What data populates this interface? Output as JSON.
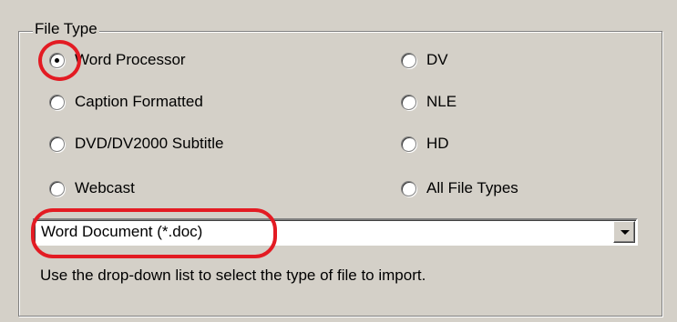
{
  "group": {
    "title": "File Type",
    "radios": [
      {
        "label": "Word Processor",
        "selected": true
      },
      {
        "label": "Caption Formatted",
        "selected": false
      },
      {
        "label": "DVD/DV2000 Subtitle",
        "selected": false
      },
      {
        "label": "Webcast",
        "selected": false
      },
      {
        "label": "DV",
        "selected": false
      },
      {
        "label": "NLE",
        "selected": false
      },
      {
        "label": "HD",
        "selected": false
      },
      {
        "label": "All File Types",
        "selected": false
      }
    ]
  },
  "dropdown": {
    "selected": "Word Document (*.doc)"
  },
  "hint": "Use the drop-down list to select the type of file to import.",
  "annotation_color": "#e31b23"
}
